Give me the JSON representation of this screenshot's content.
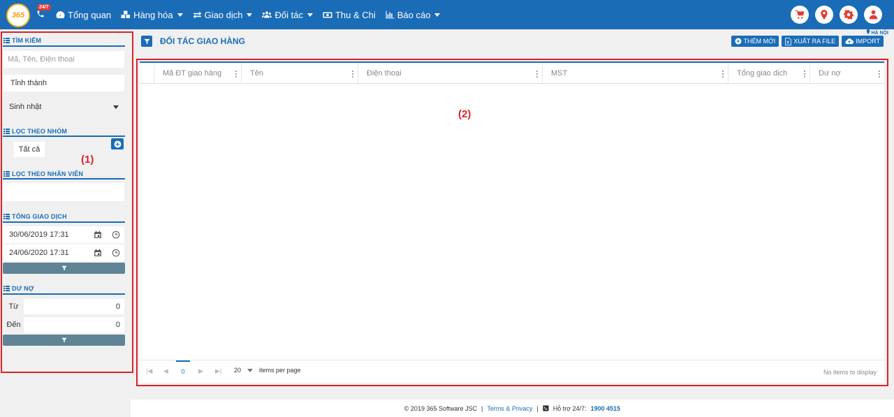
{
  "topbar": {
    "logo_text": "365",
    "badge": "24/7",
    "nav": [
      {
        "label": "Tổng quan",
        "has_dropdown": false,
        "icon": "dashboard-icon"
      },
      {
        "label": "Hàng hóa",
        "has_dropdown": true,
        "icon": "cubes-icon"
      },
      {
        "label": "Giao dịch",
        "has_dropdown": true,
        "icon": "exchange-icon"
      },
      {
        "label": "Đối tác",
        "has_dropdown": true,
        "icon": "users-icon"
      },
      {
        "label": "Thu & Chi",
        "has_dropdown": false,
        "icon": "money-icon"
      },
      {
        "label": "Báo cáo",
        "has_dropdown": true,
        "icon": "bar-chart-icon"
      }
    ],
    "right_icons": [
      "cart-icon",
      "location-icon",
      "gear-icon",
      "user-icon"
    ]
  },
  "sidebar": {
    "search_title": "TÌM KIẾM",
    "search_placeholder": "Mã, Tên, Điện thoại",
    "province": "Tỉnh thành",
    "birthday": "Sinh nhật",
    "group_title": "LỌC THEO NHÓM",
    "group_chip": "Tất cả",
    "staff_title": "LỌC THEO NHÂN VIÊN",
    "total_title": "TỔNG GIAO DỊCH",
    "date_from": "30/06/2019 17:31",
    "date_to": "24/06/2020 17:31",
    "debt_title": "DƯ NỢ",
    "debt_from_label": "Từ",
    "debt_from_value": "0",
    "debt_to_label": "Đến",
    "debt_to_value": "0"
  },
  "main": {
    "title": "ĐỐI TÁC GIAO HÀNG",
    "location": "HÀ NỘI",
    "actions": {
      "add": "THÊM MỚI",
      "export": "XUẤT RA FILE",
      "import": "IMPORT"
    },
    "columns": [
      "Mã ĐT giao hàng",
      "Tên",
      "Điện thoại",
      "MST",
      "Tổng giao dịch",
      "Dư nợ"
    ],
    "pager": {
      "current_page": "0",
      "page_size": "20",
      "per_page_label": "items per page",
      "empty_text": "No items to display"
    }
  },
  "annotations": {
    "left": "(1)",
    "right": "(2)"
  },
  "footer": {
    "copyright": "© 2019 365 Software JSC",
    "sep": "|",
    "terms": "Terms & Privacy",
    "support_label": "Hỗ trợ 24/7:",
    "hotline": "1900 4515"
  },
  "colors": {
    "primary": "#1a6cb7",
    "annotation_red": "#d8232a",
    "filter_bar": "#5f8495"
  }
}
